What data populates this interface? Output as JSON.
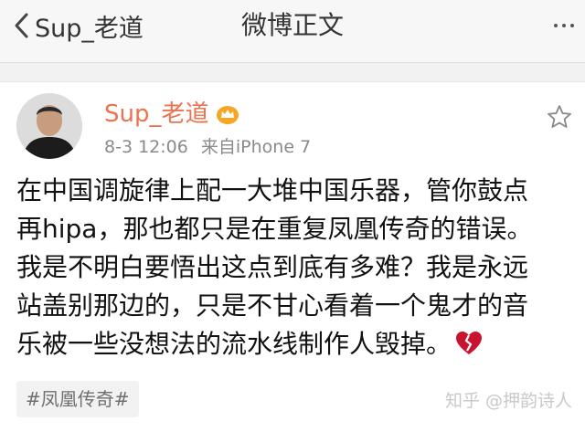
{
  "navbar": {
    "back_label": "Sup_老道",
    "title": "微博正文",
    "more_icon": "more-dots-icon"
  },
  "post": {
    "author": "Sup_老道",
    "author_badge_icon": "crown-badge-icon",
    "time": "8-3 12:06",
    "source": "来自iPhone 7",
    "lines": [
      "在中国调旋律上配一大堆中国乐器，管你鼓点",
      "再hipa，那也都只是在重复凤凰传奇的错误。",
      "我是不明白要悟出这点到底有多难？我是永远",
      "站盖别那边的，只是不甘心看着一个鬼才的音",
      "乐被一些没想法的流水线制作人毁掉。"
    ],
    "emoji_icon": "broken-heart-icon",
    "tag": "#凤凰传奇#"
  },
  "watermark": "知乎 @押韵诗人",
  "colors": {
    "accent": "#eb7350",
    "badge": "#f5a623",
    "heart": "#c8142f"
  }
}
